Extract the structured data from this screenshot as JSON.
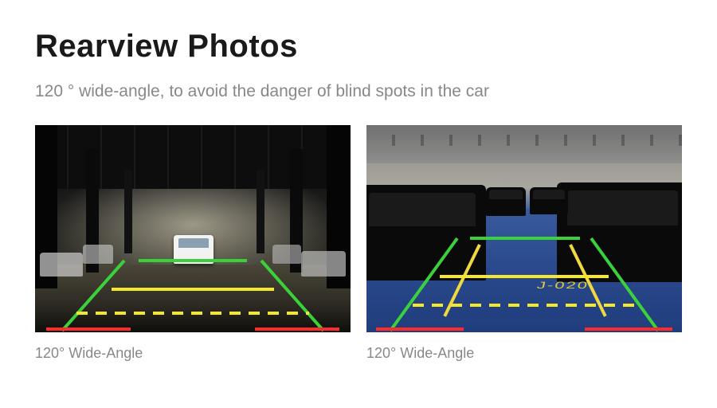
{
  "title": "Rearview Photos",
  "subtitle": "120 ° wide-angle, to avoid the danger of blind spots in the car",
  "photos": [
    {
      "caption": "120° Wide-Angle",
      "alt": "Rearview camera view — underground garage with parked cars and colored distance guidelines"
    },
    {
      "caption": "120° Wide-Angle",
      "alt": "Rearview camera view — blue-floor parking garage, bay J-020, with colored distance guidelines"
    }
  ],
  "parking_bay_label": "J-020",
  "guideline_colors": {
    "far": "#3bd13b",
    "mid": "#f5e62e",
    "near": "#ff2a2a"
  }
}
